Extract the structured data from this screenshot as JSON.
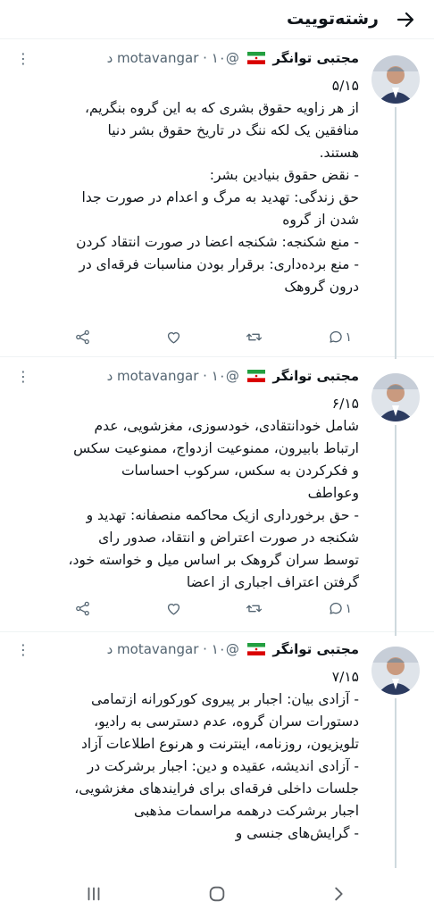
{
  "header": {
    "title": "رشته‌توییت"
  },
  "tweets": [
    {
      "name": "مجتبی توانگر",
      "handle": "@motavangar",
      "time": "۱۰ د",
      "counter": "۵/۱۵",
      "lines": [
        "از هر زاویه حقوق بشری که به این گروه بنگریم،",
        "منافقین یک لکه ننگ در تاریخ حقوق بشر دنیا",
        "هستند.",
        "- نقض حقوق بنیادین بشر:",
        "حق زندگی: تهدید به مرگ و اعدام در صورت جدا",
        "شدن از گروه",
        "- منع شکنجه: شکنجه اعضا در صورت انتقاد کردن",
        "- منع برده‌داری: برقرار بودن مناسبات فرقه‌ای در",
        "درون گروهک"
      ],
      "reply_count": "۱"
    },
    {
      "name": "مجتبی توانگر",
      "handle": "@motavangar",
      "time": "۱۰ د",
      "counter": "۶/۱۵",
      "lines": [
        "شامل خودانتقادی، خودسوزی، مغزشویی، عدم",
        "ارتباط بابیرون، ممنوعیت ازدواج، ممنوعیت سکس",
        "و فکرکردن به سکس، سرکوب احساسات وعواطف",
        "- حق برخورداری ازیک محاکمه منصفانه: تهدید و",
        "شکنجه در صورت اعتراض و انتقاد، صدور رای",
        "توسط سران گروهک بر اساس میل و خواسته خود،",
        "گرفتن اعتراف اجباری از اعضا"
      ],
      "reply_count": "۱"
    },
    {
      "name": "مجتبی توانگر",
      "handle": "@motavangar",
      "time": "۱۰ د",
      "counter": "۷/۱۵",
      "lines": [
        "- آزادی بیان: اجبار بر پیروی کورکورانه ازتمامی",
        "دستورات سران گروه، عدم دسترسی به رادیو،",
        "تلویزیون، روزنامه، اینترنت و هرنوع اطلاعات آزاد",
        "- آزادی اندیشه، عقیده و دین: اجبار برشرکت در",
        "جلسات داخلی فرقه‌ای برای فرایندهای مغزشویی،",
        "اجبار برشرکت درهمه مراسمات مذهبی",
        "- گرایش‌های جنسی و"
      ]
    }
  ],
  "icons": {
    "back": "arrow-right-icon",
    "avatar": "profile-photo",
    "flag": "iran-flag-emoji",
    "reply": "reply-icon",
    "retweet": "retweet-icon",
    "like": "heart-icon",
    "share": "share-icon",
    "nav_recent": "recent-apps-icon",
    "nav_home": "home-icon",
    "nav_back": "back-chevron-icon"
  },
  "colors": {
    "text": "#0f1419",
    "secondary": "#536471",
    "divider": "#eff3f4",
    "thread": "#cfd9de"
  }
}
